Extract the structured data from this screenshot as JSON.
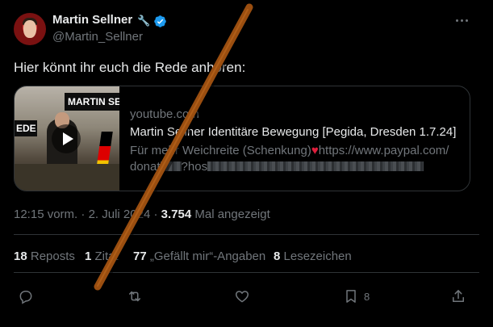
{
  "author": {
    "name": "Martin Sellner",
    "handle": "@Martin_Sellner",
    "badge_emoji": "🔧"
  },
  "tweet": {
    "text": "Hier könnt ihr euch die Rede anhören:"
  },
  "link_card": {
    "thumbnail_banner": "MARTIN SE",
    "thumbnail_side_label": "EDE",
    "domain": "youtube.com",
    "title": "Martin Sellner Identitäre Bewegung [Pegida, Dresden 1.7.24]",
    "description_prefix": "Für mehr Weichreite (Schenkung)",
    "description_link": "https://www.paypal.com/",
    "description_line2_start": "donat",
    "description_line2_mid": "?hos"
  },
  "meta": {
    "time": "12:15 vorm.",
    "separator": "·",
    "date": "2. Juli 2024",
    "views_count": "3.754",
    "views_label": "Mal angezeigt"
  },
  "stats": {
    "reposts_count": "18",
    "reposts_label": "Reposts",
    "quotes_count": "1",
    "quotes_label": "Zitat",
    "likes_count": "77",
    "likes_label": "„Gefällt mir“-Angaben",
    "bookmarks_count": "8",
    "bookmarks_label": "Lesezeichen"
  },
  "actions": {
    "bookmark_count": "8"
  },
  "colors": {
    "background": "#000000",
    "text_primary": "#e7e9ea",
    "text_secondary": "#71767b",
    "border": "#2f3336",
    "verified_blue": "#1d9bf0",
    "stroke_orange": "#9a4e10"
  },
  "icons": [
    "verified-icon",
    "more-icon",
    "play-icon",
    "reply-icon",
    "repost-icon",
    "like-icon",
    "bookmark-icon",
    "share-icon"
  ]
}
